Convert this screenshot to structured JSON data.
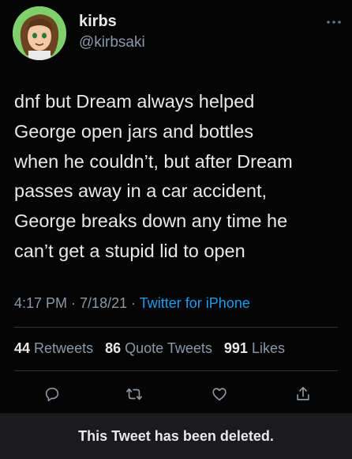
{
  "user": {
    "display_name": "kirbs",
    "handle": "@kirbsaki"
  },
  "menu": {
    "icon": "more-dots-icon"
  },
  "tweet": {
    "text": "dnf but Dream always helped\nGeorge open jars and bottles\nwhen he couldn’t, but after Dream\npasses away in a car accident,\nGeorge breaks down any time he\ncan’t get a stupid lid to open",
    "time": "4:17 PM",
    "date": "7/18/21",
    "source": "Twitter for iPhone",
    "separator": " · "
  },
  "stats": {
    "retweets_count": "44",
    "retweets_label": "Retweets",
    "quotes_count": "86",
    "quotes_label": "Quote Tweets",
    "likes_count": "991",
    "likes_label": "Likes"
  },
  "actions": [
    {
      "name": "reply",
      "icon": "reply-icon"
    },
    {
      "name": "retweet",
      "icon": "retweet-icon"
    },
    {
      "name": "like",
      "icon": "heart-icon"
    },
    {
      "name": "share",
      "icon": "share-icon"
    }
  ],
  "banner": {
    "text": "This Tweet has been deleted."
  },
  "colors": {
    "background": "#000000",
    "text": "#e7e9ea",
    "secondary": "#8b98a5",
    "link": "#1d9bf0",
    "divider": "#2f3336",
    "banner_bg": "#1b1b1d"
  }
}
